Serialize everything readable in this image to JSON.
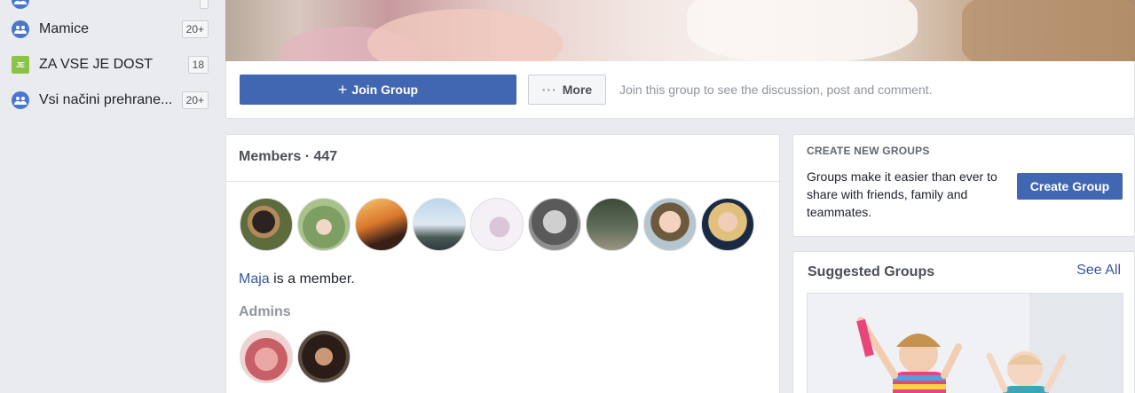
{
  "sidebar": {
    "items": [
      {
        "label": "",
        "badge": "",
        "icon": "group-icon"
      },
      {
        "label": "Mamice",
        "badge": "20+",
        "icon": "group-icon"
      },
      {
        "label": "ZA VSE JE DOST",
        "badge": "18",
        "icon": "group-square-icon"
      },
      {
        "label": "Vsi načini prehrane...",
        "badge": "20+",
        "icon": "group-icon"
      }
    ]
  },
  "group": {
    "join_label": "Join Group",
    "more_label": "More",
    "join_hint": "Join this group to see the discussion, post and comment."
  },
  "members": {
    "title": "Members · 447",
    "friend_name": "Maja",
    "friend_suffix": " is a member.",
    "admins_title": "Admins",
    "avatar_count": 9,
    "admin_count": 2
  },
  "create_groups": {
    "heading": "CREATE NEW GROUPS",
    "description": "Groups make it easier than ever to share with friends, family and teammates.",
    "button_label": "Create Group"
  },
  "suggested": {
    "title": "Suggested Groups",
    "see_all": "See All"
  },
  "colors": {
    "primary": "#4267b2",
    "link": "#365899",
    "background": "#e9ebee"
  }
}
